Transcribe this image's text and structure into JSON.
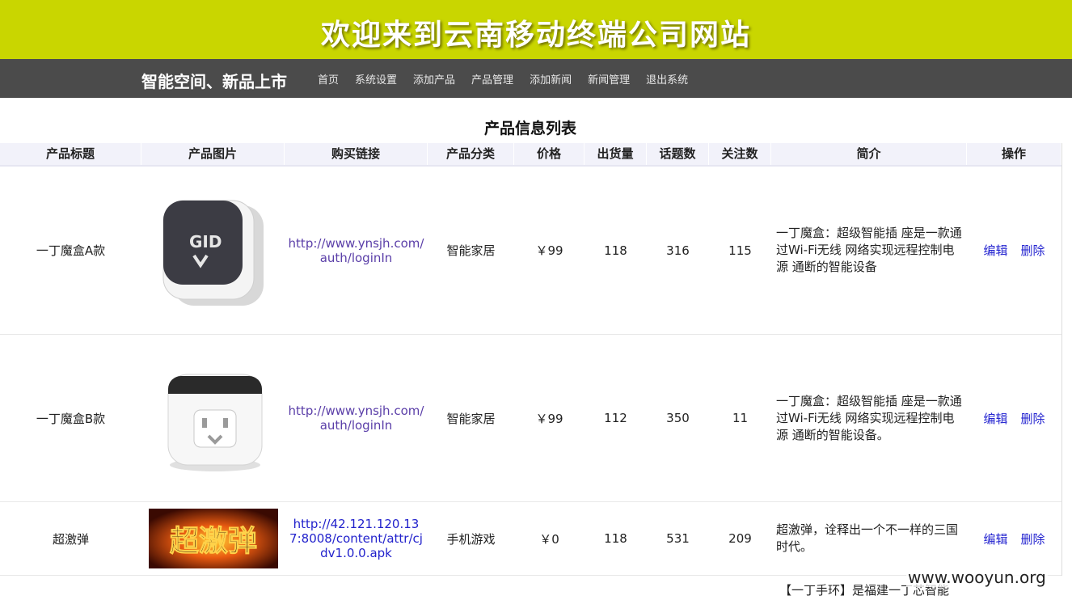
{
  "banner": {
    "title": "欢迎来到云南移动终端公司网站",
    "bg_color": "#c9d600"
  },
  "navbar": {
    "brand": "智能空间、新品上市",
    "links": [
      "首页",
      "系统设置",
      "添加产品",
      "产品管理",
      "添加新闻",
      "新闻管理",
      "退出系统"
    ]
  },
  "table": {
    "title": "产品信息列表",
    "headers": [
      "产品标题",
      "产品图片",
      "购买链接",
      "产品分类",
      "价格",
      "出货量",
      "话题数",
      "关注数",
      "简介",
      "操作"
    ],
    "rows": [
      {
        "name": "一丁魔盒A款",
        "image": "dark-smart-plug-image",
        "link": "http://www.ynsjh.com/auth/loginIn",
        "category": "智能家居",
        "price": "￥99",
        "shipments": "118",
        "topics": "316",
        "followers": "115",
        "desc": "一丁魔盒：超级智能插 座是一款通过Wi-Fi无线 网络实现远程控制电源 通断的智能设备",
        "edit": "编辑",
        "delete": "删除"
      },
      {
        "name": "一丁魔盒B款",
        "image": "white-smart-plug-image",
        "link": "http://www.ynsjh.com/auth/loginIn",
        "category": "智能家居",
        "price": "￥99",
        "shipments": "112",
        "topics": "350",
        "followers": "11",
        "desc": "一丁魔盒：超级智能插 座是一款通过Wi-Fi无线 网络实现远程控制电源 通断的智能设备。",
        "edit": "编辑",
        "delete": "删除"
      },
      {
        "name": "超激弹",
        "image": "game-banner-image",
        "image_text": "超激弹",
        "link": "http://42.121.120.137:8008/content/attr/cjdv1.0.0.apk",
        "category": "手机游戏",
        "price": "￥0",
        "shipments": "118",
        "topics": "531",
        "followers": "209",
        "desc": "超激弹，诠释出一个不一样的三国时代。",
        "edit": "编辑",
        "delete": "删除"
      }
    ]
  },
  "footer_text": "【一丁手环】是福建一丁芯智能",
  "watermark": "www.wooyun.org"
}
